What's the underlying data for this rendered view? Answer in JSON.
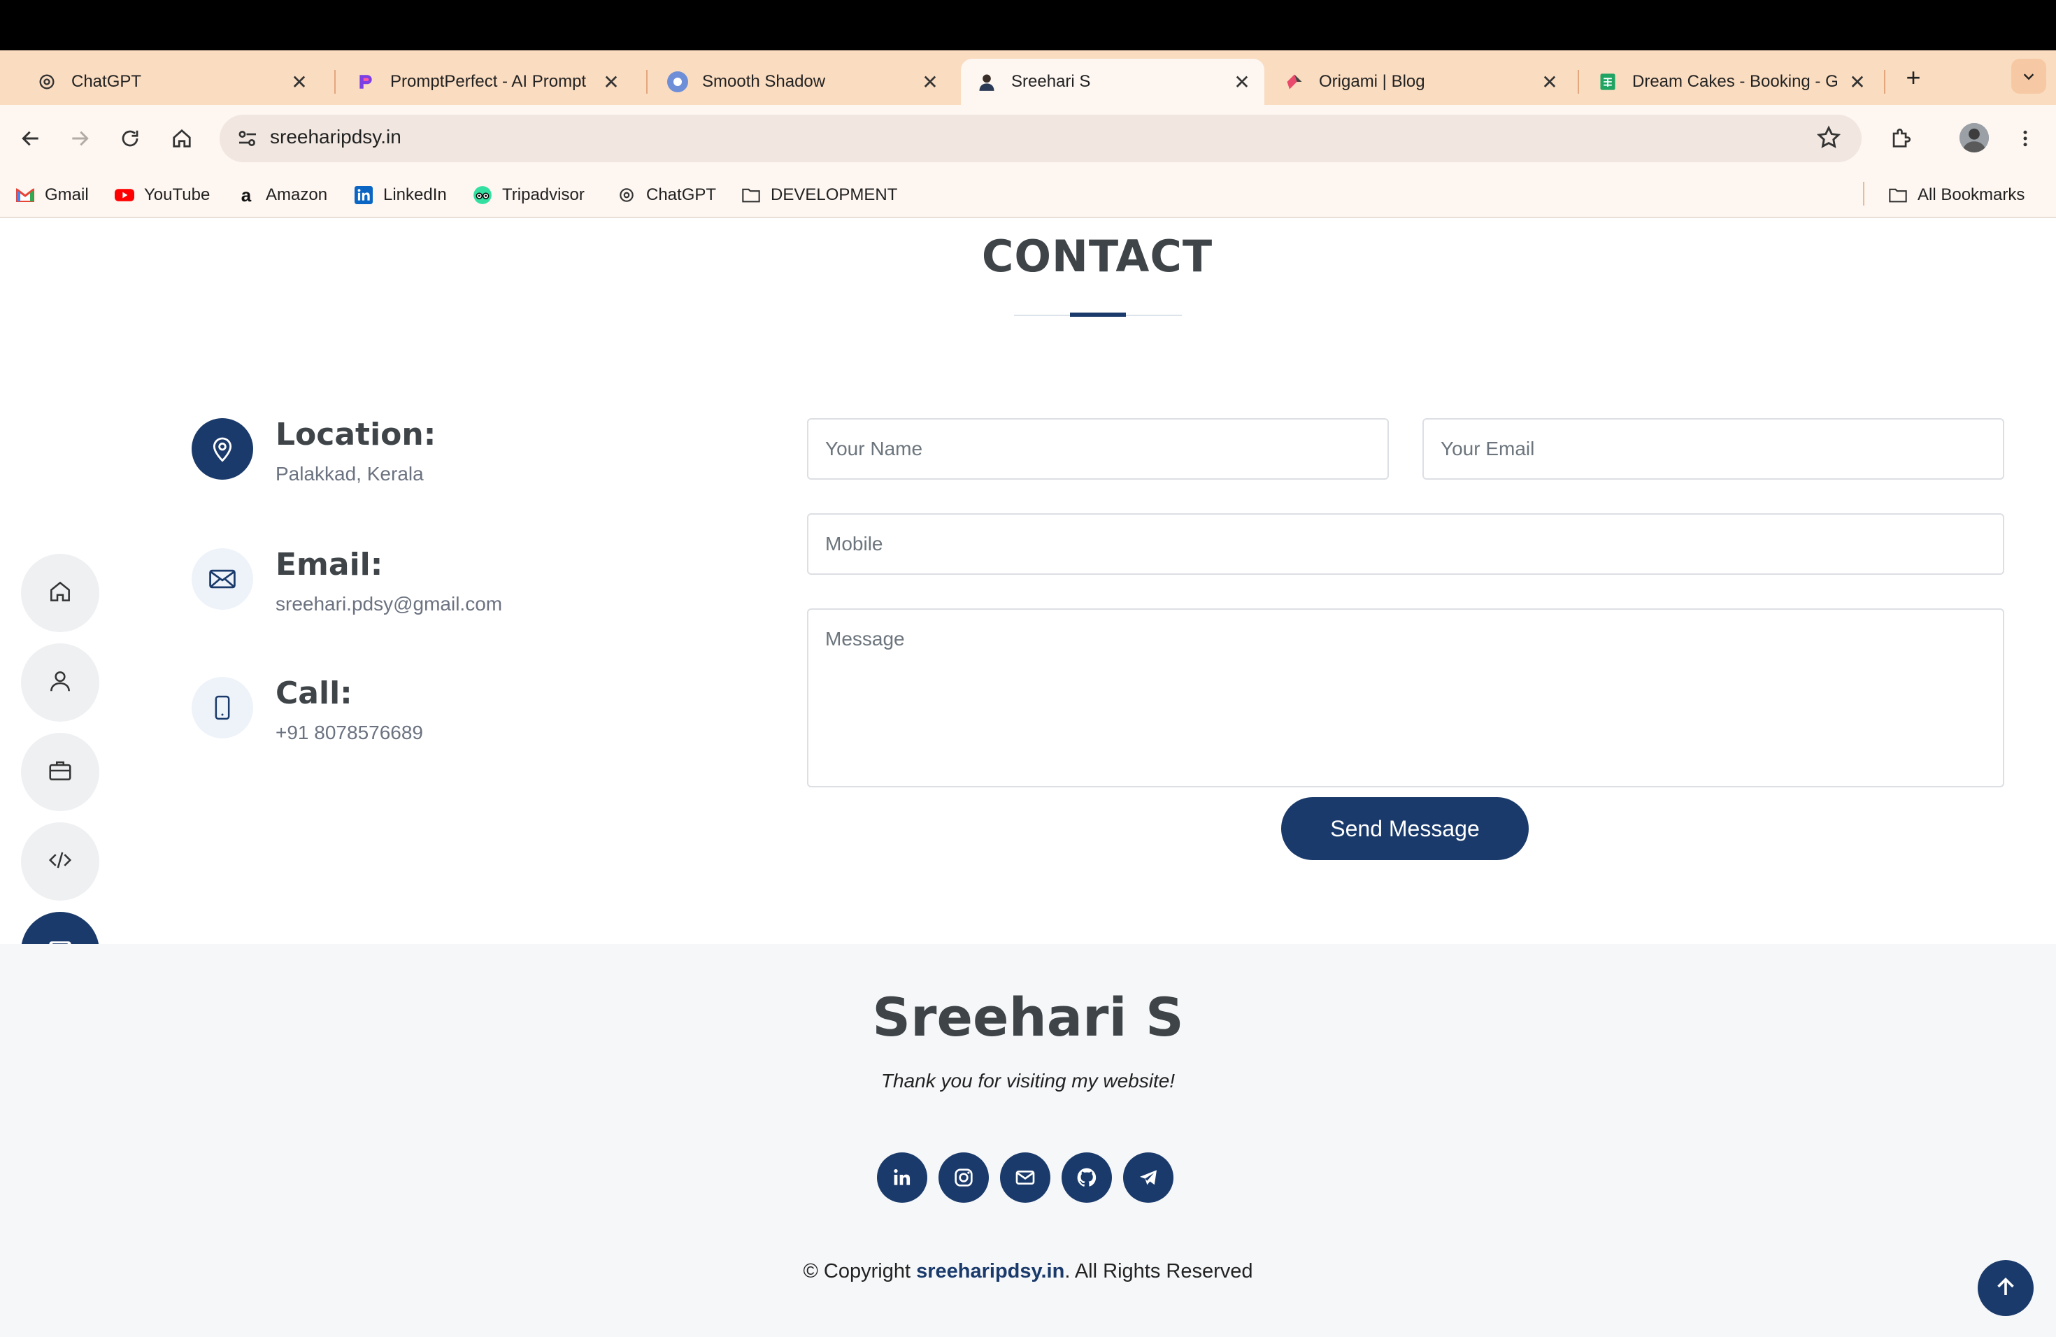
{
  "browser": {
    "tabs": [
      {
        "title": "ChatGPT",
        "icon": "chatgpt-icon"
      },
      {
        "title": "PromptPerfect - AI Prompt",
        "icon": "promptperfect-icon"
      },
      {
        "title": "Smooth Shadow",
        "icon": "smooth-shadow-icon"
      },
      {
        "title": "Sreehari S",
        "icon": "profile-favicon",
        "active": true
      },
      {
        "title": "Origami | Blog",
        "icon": "origami-icon"
      },
      {
        "title": "Dream Cakes - Booking - G",
        "icon": "sheets-icon"
      }
    ],
    "new_tab": "+",
    "url": "sreeharipdsy.in",
    "bookmarks": [
      "Gmail",
      "YouTube",
      "Amazon",
      "LinkedIn",
      "Tripadvisor",
      "ChatGPT",
      "DEVELOPMENT"
    ],
    "all_bookmarks": "All Bookmarks"
  },
  "contact": {
    "title": "CONTACT",
    "items": [
      {
        "label": "Location:",
        "value": "Palakkad, Kerala",
        "icon": "location-pin-icon"
      },
      {
        "label": "Email:",
        "value": "sreehari.pdsy@gmail.com",
        "icon": "envelope-icon"
      },
      {
        "label": "Call:",
        "value": "+91 8078576689",
        "icon": "phone-icon"
      }
    ],
    "form": {
      "name_placeholder": "Your Name",
      "email_placeholder": "Your Email",
      "mobile_placeholder": "Mobile",
      "message_placeholder": "Message",
      "send_label": "Send Message"
    }
  },
  "sidenav": [
    "home-icon",
    "user-icon",
    "briefcase-icon",
    "code-icon",
    "envelope-icon"
  ],
  "footer": {
    "name": "Sreehari S",
    "tagline": "Thank you for visiting my website!",
    "socials": [
      "linkedin-icon",
      "instagram-icon",
      "email-icon",
      "github-icon",
      "telegram-icon"
    ],
    "copyright_prefix": "© Copyright ",
    "copyright_site": "sreeharipdsy.in",
    "copyright_suffix": ". All Rights Reserved"
  },
  "colors": {
    "accent": "#1a3a6b",
    "tabstrip": "#fadcc0",
    "chrome": "#fdf6f1"
  }
}
